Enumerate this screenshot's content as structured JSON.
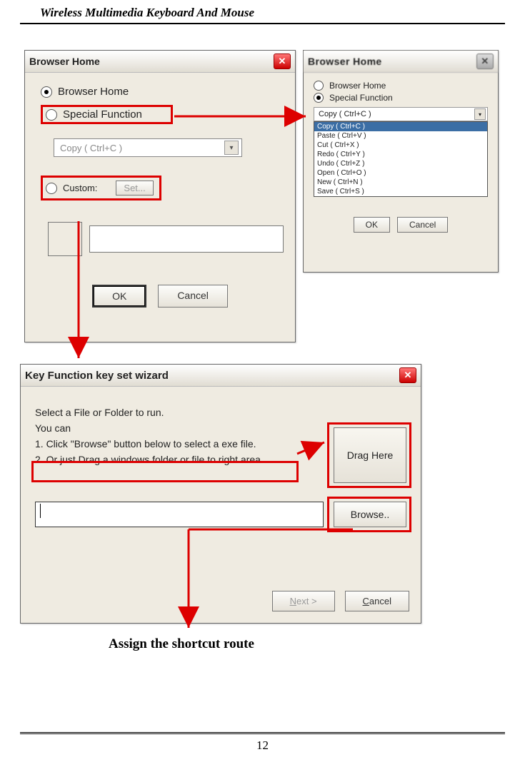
{
  "header": {
    "title": "Wireless Multimedia Keyboard And Mouse"
  },
  "footer": {
    "page_number": "12"
  },
  "caption": "Assign the shortcut route",
  "dialog1": {
    "title": "Browser Home",
    "opt_browser_home": "Browser Home",
    "opt_special_function": "Special Function",
    "combo_value": "Copy ( Ctrl+C )",
    "opt_custom": "Custom:",
    "btn_set": "Set...",
    "btn_ok": "OK",
    "btn_cancel": "Cancel"
  },
  "dialog2": {
    "title": "Browser Home",
    "opt_browser_home": "Browser Home",
    "opt_special_function": "Special Function",
    "combo_value": "Copy ( Ctrl+C )",
    "list": {
      "i0": "Copy ( Ctrl+C )",
      "i1": "Paste ( Ctrl+V )",
      "i2": "Cut ( Ctrl+X )",
      "i3": "Redo ( Ctrl+Y )",
      "i4": "Undo ( Ctrl+Z )",
      "i5": "Open ( Ctrl+O )",
      "i6": "New ( Ctrl+N )",
      "i7": "Save ( Ctrl+S )"
    },
    "btn_ok": "OK",
    "btn_cancel": "Cancel"
  },
  "dialog3": {
    "title": "Key Function key  set wizard",
    "line1": "Select a File or Folder to run.",
    "line2": "You can",
    "line3": "1. Click \"Browse\" button below to select a exe file.",
    "line4": "2. Or just Drag a windows folder or file to right area.",
    "drag_here": "Drag Here",
    "browse": "Browse..",
    "next": "Next >",
    "cancel": "Cancel"
  }
}
